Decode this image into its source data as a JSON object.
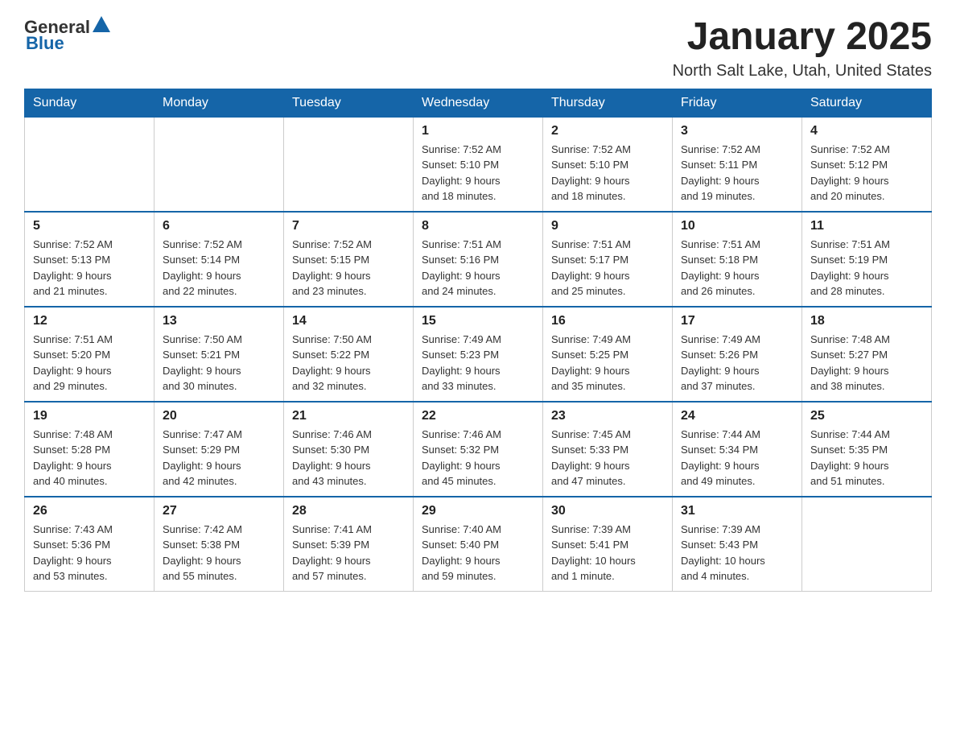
{
  "header": {
    "logo_general": "General",
    "logo_blue": "Blue",
    "title": "January 2025",
    "subtitle": "North Salt Lake, Utah, United States"
  },
  "weekdays": [
    "Sunday",
    "Monday",
    "Tuesday",
    "Wednesday",
    "Thursday",
    "Friday",
    "Saturday"
  ],
  "weeks": [
    [
      {
        "day": "",
        "info": ""
      },
      {
        "day": "",
        "info": ""
      },
      {
        "day": "",
        "info": ""
      },
      {
        "day": "1",
        "info": "Sunrise: 7:52 AM\nSunset: 5:10 PM\nDaylight: 9 hours\nand 18 minutes."
      },
      {
        "day": "2",
        "info": "Sunrise: 7:52 AM\nSunset: 5:10 PM\nDaylight: 9 hours\nand 18 minutes."
      },
      {
        "day": "3",
        "info": "Sunrise: 7:52 AM\nSunset: 5:11 PM\nDaylight: 9 hours\nand 19 minutes."
      },
      {
        "day": "4",
        "info": "Sunrise: 7:52 AM\nSunset: 5:12 PM\nDaylight: 9 hours\nand 20 minutes."
      }
    ],
    [
      {
        "day": "5",
        "info": "Sunrise: 7:52 AM\nSunset: 5:13 PM\nDaylight: 9 hours\nand 21 minutes."
      },
      {
        "day": "6",
        "info": "Sunrise: 7:52 AM\nSunset: 5:14 PM\nDaylight: 9 hours\nand 22 minutes."
      },
      {
        "day": "7",
        "info": "Sunrise: 7:52 AM\nSunset: 5:15 PM\nDaylight: 9 hours\nand 23 minutes."
      },
      {
        "day": "8",
        "info": "Sunrise: 7:51 AM\nSunset: 5:16 PM\nDaylight: 9 hours\nand 24 minutes."
      },
      {
        "day": "9",
        "info": "Sunrise: 7:51 AM\nSunset: 5:17 PM\nDaylight: 9 hours\nand 25 minutes."
      },
      {
        "day": "10",
        "info": "Sunrise: 7:51 AM\nSunset: 5:18 PM\nDaylight: 9 hours\nand 26 minutes."
      },
      {
        "day": "11",
        "info": "Sunrise: 7:51 AM\nSunset: 5:19 PM\nDaylight: 9 hours\nand 28 minutes."
      }
    ],
    [
      {
        "day": "12",
        "info": "Sunrise: 7:51 AM\nSunset: 5:20 PM\nDaylight: 9 hours\nand 29 minutes."
      },
      {
        "day": "13",
        "info": "Sunrise: 7:50 AM\nSunset: 5:21 PM\nDaylight: 9 hours\nand 30 minutes."
      },
      {
        "day": "14",
        "info": "Sunrise: 7:50 AM\nSunset: 5:22 PM\nDaylight: 9 hours\nand 32 minutes."
      },
      {
        "day": "15",
        "info": "Sunrise: 7:49 AM\nSunset: 5:23 PM\nDaylight: 9 hours\nand 33 minutes."
      },
      {
        "day": "16",
        "info": "Sunrise: 7:49 AM\nSunset: 5:25 PM\nDaylight: 9 hours\nand 35 minutes."
      },
      {
        "day": "17",
        "info": "Sunrise: 7:49 AM\nSunset: 5:26 PM\nDaylight: 9 hours\nand 37 minutes."
      },
      {
        "day": "18",
        "info": "Sunrise: 7:48 AM\nSunset: 5:27 PM\nDaylight: 9 hours\nand 38 minutes."
      }
    ],
    [
      {
        "day": "19",
        "info": "Sunrise: 7:48 AM\nSunset: 5:28 PM\nDaylight: 9 hours\nand 40 minutes."
      },
      {
        "day": "20",
        "info": "Sunrise: 7:47 AM\nSunset: 5:29 PM\nDaylight: 9 hours\nand 42 minutes."
      },
      {
        "day": "21",
        "info": "Sunrise: 7:46 AM\nSunset: 5:30 PM\nDaylight: 9 hours\nand 43 minutes."
      },
      {
        "day": "22",
        "info": "Sunrise: 7:46 AM\nSunset: 5:32 PM\nDaylight: 9 hours\nand 45 minutes."
      },
      {
        "day": "23",
        "info": "Sunrise: 7:45 AM\nSunset: 5:33 PM\nDaylight: 9 hours\nand 47 minutes."
      },
      {
        "day": "24",
        "info": "Sunrise: 7:44 AM\nSunset: 5:34 PM\nDaylight: 9 hours\nand 49 minutes."
      },
      {
        "day": "25",
        "info": "Sunrise: 7:44 AM\nSunset: 5:35 PM\nDaylight: 9 hours\nand 51 minutes."
      }
    ],
    [
      {
        "day": "26",
        "info": "Sunrise: 7:43 AM\nSunset: 5:36 PM\nDaylight: 9 hours\nand 53 minutes."
      },
      {
        "day": "27",
        "info": "Sunrise: 7:42 AM\nSunset: 5:38 PM\nDaylight: 9 hours\nand 55 minutes."
      },
      {
        "day": "28",
        "info": "Sunrise: 7:41 AM\nSunset: 5:39 PM\nDaylight: 9 hours\nand 57 minutes."
      },
      {
        "day": "29",
        "info": "Sunrise: 7:40 AM\nSunset: 5:40 PM\nDaylight: 9 hours\nand 59 minutes."
      },
      {
        "day": "30",
        "info": "Sunrise: 7:39 AM\nSunset: 5:41 PM\nDaylight: 10 hours\nand 1 minute."
      },
      {
        "day": "31",
        "info": "Sunrise: 7:39 AM\nSunset: 5:43 PM\nDaylight: 10 hours\nand 4 minutes."
      },
      {
        "day": "",
        "info": ""
      }
    ]
  ]
}
